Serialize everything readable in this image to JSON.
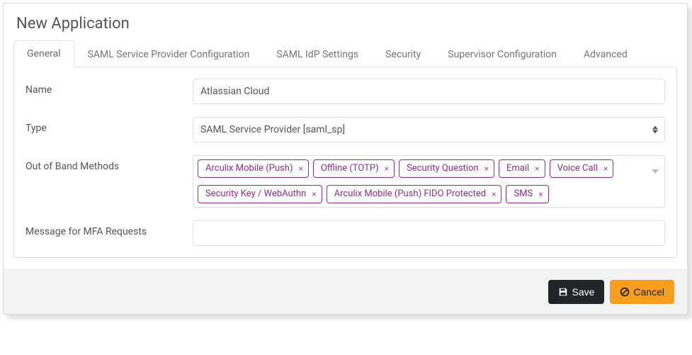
{
  "dialog_title": "New Application",
  "tabs": [
    {
      "id": "general",
      "label": "General",
      "active": true
    },
    {
      "id": "saml-sp",
      "label": "SAML Service Provider Configuration",
      "active": false
    },
    {
      "id": "saml-idp",
      "label": "SAML IdP Settings",
      "active": false
    },
    {
      "id": "security",
      "label": "Security",
      "active": false
    },
    {
      "id": "supervisor",
      "label": "Supervisor Configuration",
      "active": false
    },
    {
      "id": "advanced",
      "label": "Advanced",
      "active": false
    }
  ],
  "form": {
    "name": {
      "label": "Name",
      "value": "Atlassian Cloud"
    },
    "type": {
      "label": "Type",
      "value": "SAML Service Provider [saml_sp]"
    },
    "oob_methods": {
      "label": "Out of Band Methods",
      "values": [
        "Arculix Mobile (Push)",
        "Offline (TOTP)",
        "Security Question",
        "Email",
        "Voice Call",
        "Security Key / WebAuthn",
        "Arculix Mobile (Push) FIDO Protected",
        "SMS"
      ]
    },
    "mfa_message": {
      "label": "Message for MFA Requests",
      "value": ""
    }
  },
  "buttons": {
    "save": "Save",
    "cancel": "Cancel"
  }
}
